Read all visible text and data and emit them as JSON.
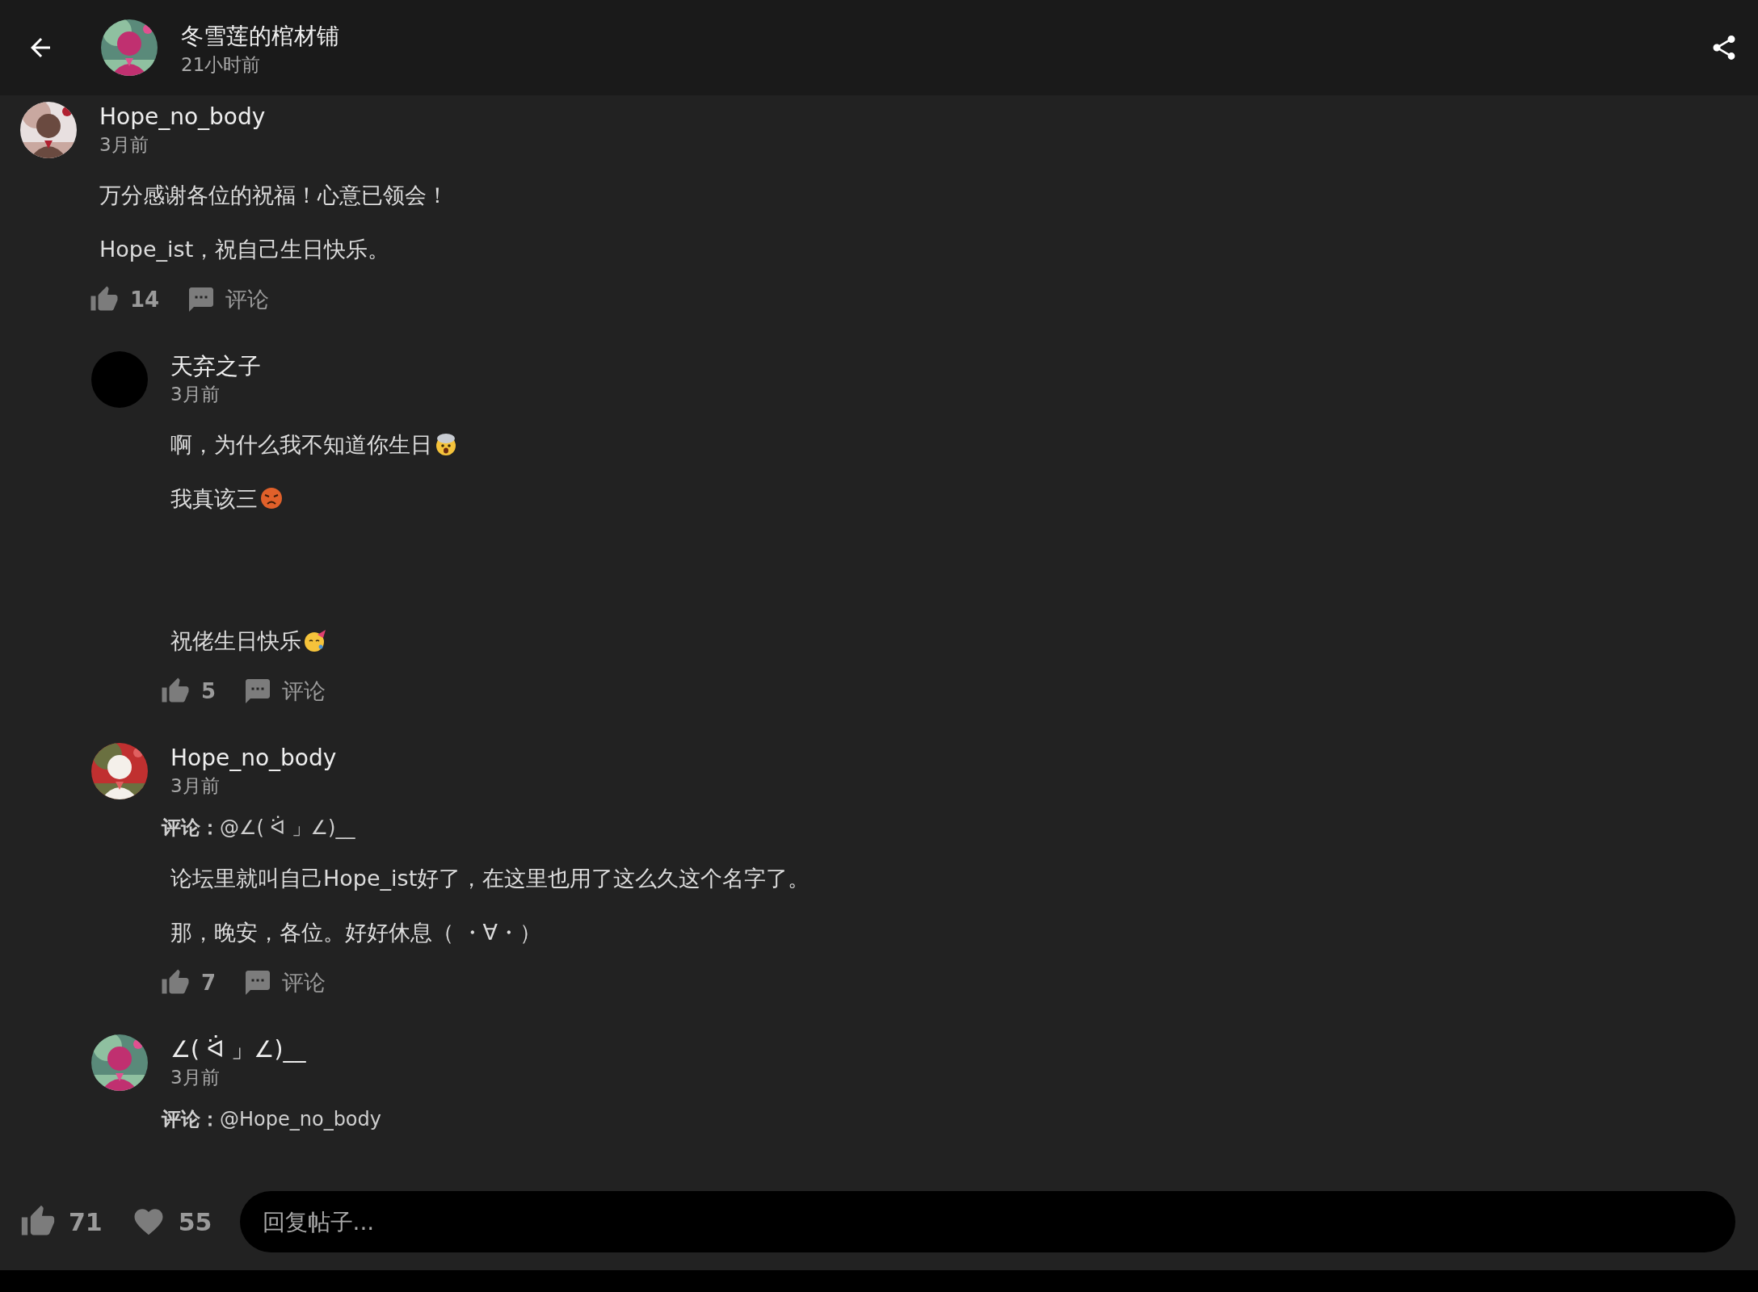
{
  "header": {
    "title": "冬雪莲的棺材铺",
    "time": "21小时前",
    "avatar": {
      "kind": "picture"
    }
  },
  "comments": [
    {
      "author": "Hope_no_body",
      "time": "3月前",
      "avatar": {
        "kind": "picture"
      },
      "blocks": [
        [
          {
            "text": "万分感谢各位的祝福！心意已领会！"
          },
          {
            "text": "Hope_ist，祝自己生日快乐。"
          }
        ]
      ],
      "likes": "14",
      "comment_label": "评论",
      "children": [
        {
          "author": "天弃之子",
          "time": "3月前",
          "avatar": {
            "kind": "blank"
          },
          "blocks": [
            [
              {
                "text": "啊，为什么我不知道你生日",
                "kind": "exploding"
              },
              {
                "text": "我真该三",
                "kind": "angry"
              }
            ],
            [
              {
                "text": "祝佬生日快乐",
                "kind": "party"
              }
            ]
          ],
          "likes": "5",
          "comment_label": "评论"
        },
        {
          "author": "Hope_no_body",
          "time": "3月前",
          "avatar": {
            "kind": "picture"
          },
          "reply_to": {
            "label": "评论：",
            "target": "@∠( ᐛ 」∠)__"
          },
          "blocks": [
            [
              {
                "text": "论坛里就叫自己Hope_ist好了，在这里也用了这么久这个名字了。"
              },
              {
                "text": "那，晚安，各位。好好休息（ ・∀・）"
              }
            ]
          ],
          "likes": "7",
          "comment_label": "评论"
        },
        {
          "author": "∠( ᐛ 」∠)__",
          "time": "3月前",
          "avatar": {
            "kind": "picture"
          },
          "reply_to": {
            "label": "评论：",
            "target": "@Hope_no_body"
          }
        }
      ]
    }
  ],
  "footer": {
    "likes": "71",
    "favorites": "55",
    "reply": {
      "placeholder": "回复帖子..."
    }
  }
}
